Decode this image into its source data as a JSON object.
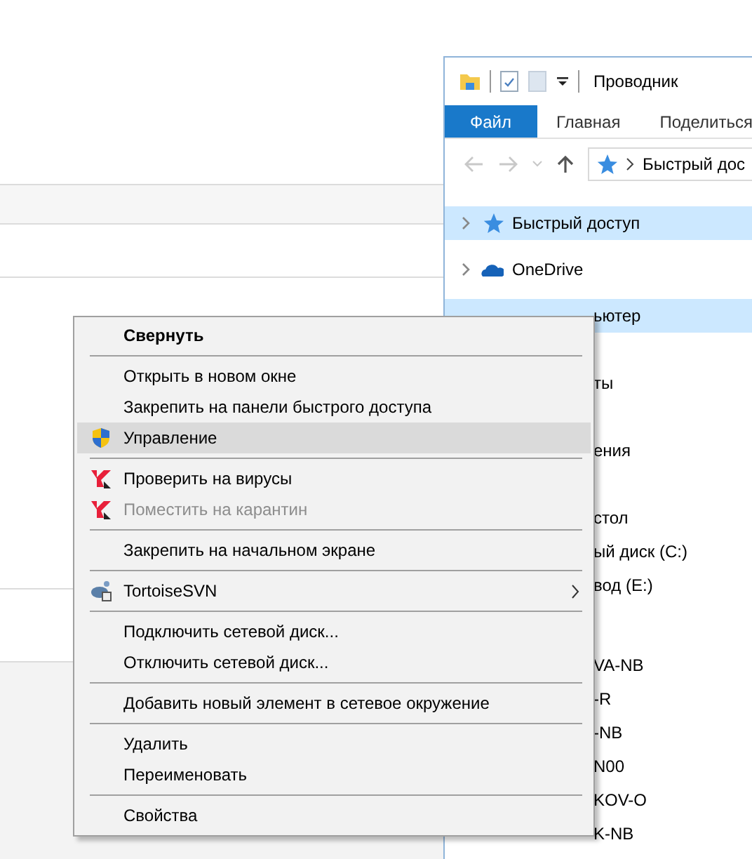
{
  "explorer": {
    "title": "Проводник",
    "tabs": [
      {
        "label": "Файл",
        "selected": true
      },
      {
        "label": "Главная",
        "selected": false
      },
      {
        "label": "Поделиться",
        "selected": false
      }
    ],
    "address": "Быстрый дос",
    "tree": [
      {
        "kind": "quick-access",
        "label": "Быстрый доступ",
        "selected": true
      },
      {
        "kind": "cloud-drive",
        "label": "OneDrive",
        "selected": false
      },
      {
        "kind": "cut",
        "label": "ьютер",
        "selected": true
      },
      {
        "kind": "cut",
        "label": "ты",
        "selected": false
      },
      {
        "kind": "cut",
        "label": "ения",
        "selected": false
      },
      {
        "kind": "cut",
        "label": "стол",
        "selected": false
      },
      {
        "kind": "cut",
        "label": "ый диск (C:)",
        "selected": false
      },
      {
        "kind": "cut",
        "label": "вод (E:)",
        "selected": false
      },
      {
        "kind": "cut",
        "label": "VA-NB",
        "selected": false
      },
      {
        "kind": "cut",
        "label": "-R",
        "selected": false
      },
      {
        "kind": "cut",
        "label": "-NB",
        "selected": false
      },
      {
        "kind": "cut",
        "label": "N00",
        "selected": false
      },
      {
        "kind": "cut",
        "label": "KOV-O",
        "selected": false
      },
      {
        "kind": "cut",
        "label": "K-NB",
        "selected": false
      }
    ]
  },
  "context_menu": [
    {
      "kind": "command",
      "label": "Свернуть",
      "bold": true,
      "disabled": false,
      "selected": false
    },
    {
      "kind": "separator"
    },
    {
      "kind": "command",
      "label": "Открыть в новом окне",
      "bold": false,
      "disabled": false,
      "selected": false
    },
    {
      "kind": "command",
      "label": "Закрепить на панели быстрого доступа",
      "bold": false,
      "disabled": false,
      "selected": false
    },
    {
      "kind": "admin-command",
      "label": "Управление",
      "bold": false,
      "disabled": false,
      "selected": true
    },
    {
      "kind": "separator"
    },
    {
      "kind": "scan-command",
      "label": "Проверить на вирусы",
      "bold": false,
      "disabled": false,
      "selected": false
    },
    {
      "kind": "scan-command",
      "label": "Поместить на карантин",
      "bold": false,
      "disabled": true,
      "selected": false
    },
    {
      "kind": "separator"
    },
    {
      "kind": "command",
      "label": "Закрепить на начальном экране",
      "bold": false,
      "disabled": false,
      "selected": false
    },
    {
      "kind": "separator"
    },
    {
      "kind": "svn-submenu",
      "label": "TortoiseSVN",
      "bold": false,
      "disabled": false,
      "selected": false
    },
    {
      "kind": "separator"
    },
    {
      "kind": "command",
      "label": "Подключить сетевой диск...",
      "bold": false,
      "disabled": false,
      "selected": false
    },
    {
      "kind": "command",
      "label": "Отключить сетевой диск...",
      "bold": false,
      "disabled": false,
      "selected": false
    },
    {
      "kind": "separator"
    },
    {
      "kind": "command",
      "label": "Добавить новый элемент в сетевое окружение",
      "bold": false,
      "disabled": false,
      "selected": false
    },
    {
      "kind": "separator"
    },
    {
      "kind": "command",
      "label": "Удалить",
      "bold": false,
      "disabled": false,
      "selected": false
    },
    {
      "kind": "command",
      "label": "Переименовать",
      "bold": false,
      "disabled": false,
      "selected": false
    },
    {
      "kind": "separator"
    },
    {
      "kind": "command",
      "label": "Свойства",
      "bold": false,
      "disabled": false,
      "selected": false
    }
  ]
}
